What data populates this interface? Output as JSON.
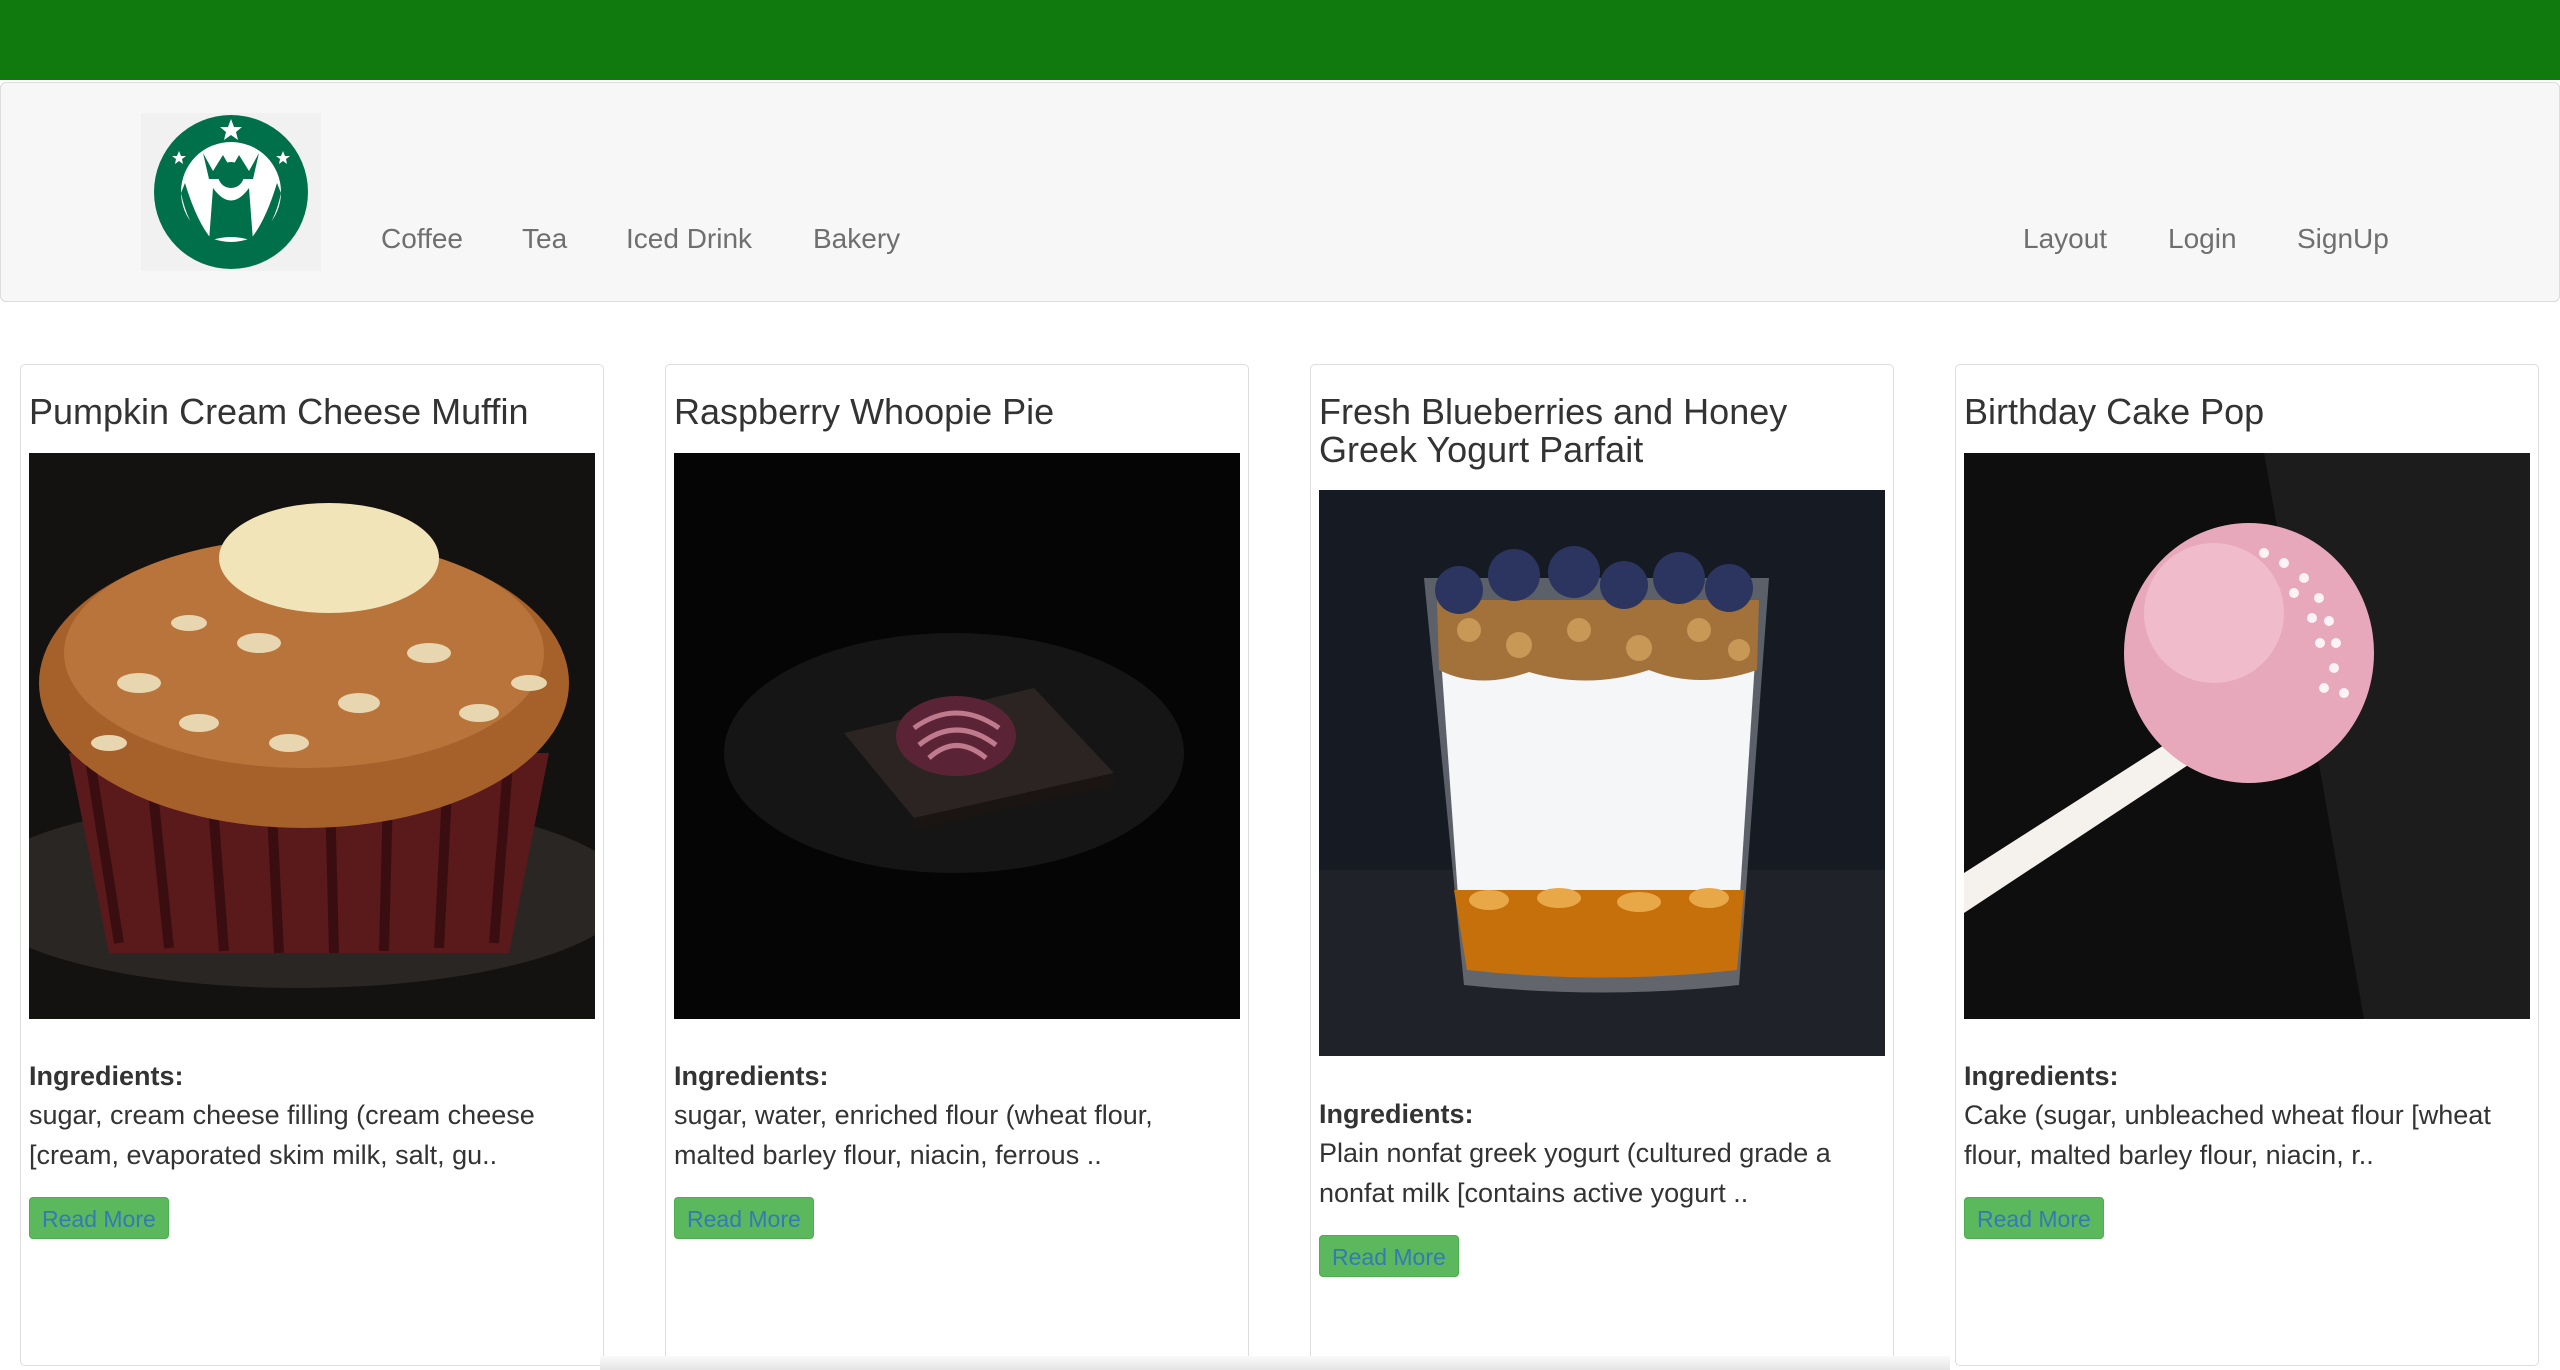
{
  "nav": {
    "left": [
      "Coffee",
      "Tea",
      "Iced Drink",
      "Bakery"
    ],
    "right": [
      "Layout",
      "Login",
      "SignUp"
    ]
  },
  "colors": {
    "topbar": "#117a0f",
    "button": "#5cb85c",
    "link": "#337ab7",
    "logo_green": "#00704a"
  },
  "cards": [
    {
      "title": "Pumpkin Cream Cheese Muffin",
      "ingredients_label": "Ingredients:",
      "ingredients": "sugar, cream cheese filling (cream cheese [cream, evaporated skim milk, salt, gu..",
      "button": "Read More"
    },
    {
      "title": "Raspberry Whoopie Pie",
      "ingredients_label": "Ingredients:",
      "ingredients": "sugar, water, enriched flour (wheat flour, malted barley flour, niacin, ferrous ..",
      "button": "Read More"
    },
    {
      "title": "Fresh Blueberries and Honey Greek Yogurt Parfait",
      "ingredients_label": "Ingredients:",
      "ingredients": "Plain nonfat greek yogurt (cultured grade a nonfat milk [contains active yogurt ..",
      "button": "Read More"
    },
    {
      "title": "Birthday Cake Pop",
      "ingredients_label": "Ingredients:",
      "ingredients": "Cake (sugar, unbleached wheat flour [wheat flour, malted barley flour, niacin, r..",
      "button": "Read More"
    }
  ]
}
